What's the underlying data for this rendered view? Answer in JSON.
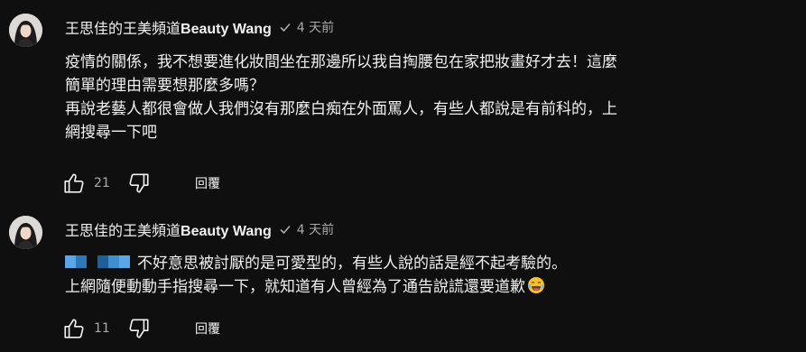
{
  "comments": [
    {
      "author_cjk": "王思佳的王美頻道",
      "author_latin": "Beauty Wang",
      "verified_icon": "check-icon",
      "time": "4 天前",
      "lines": [
        "疫情的關係，我不想要進化妝間坐在那邊所以我自掏腰包在家把妝畫好才去！這麼",
        "簡單的理由需要想那麼多嗎？",
        "再說老藝人都很會做人我們沒有那麼白痴在外面罵人，有些人都說是有前科的，上",
        "網搜尋一下吧"
      ],
      "like_count": "21",
      "reply_label": "回覆"
    },
    {
      "author_cjk": "王思佳的王美頻道",
      "author_latin": "Beauty Wang",
      "verified_icon": "check-icon",
      "time": "4 天前",
      "line1": "不好意思被討厭的是可愛型的，有些人說的話是經不起考驗的。",
      "line2": "上網隨便動動手指搜尋一下，就知道有人曾經為了通告說謊還要道歉",
      "emoji_icon": "laughing-tears-emoji",
      "like_count": "11",
      "reply_label": "回覆"
    }
  ],
  "colors": {
    "background": "#0f0f0f",
    "text": "#f1f1f1",
    "secondary": "#aaaaaa",
    "mention_blue": "#3e8ed0"
  }
}
